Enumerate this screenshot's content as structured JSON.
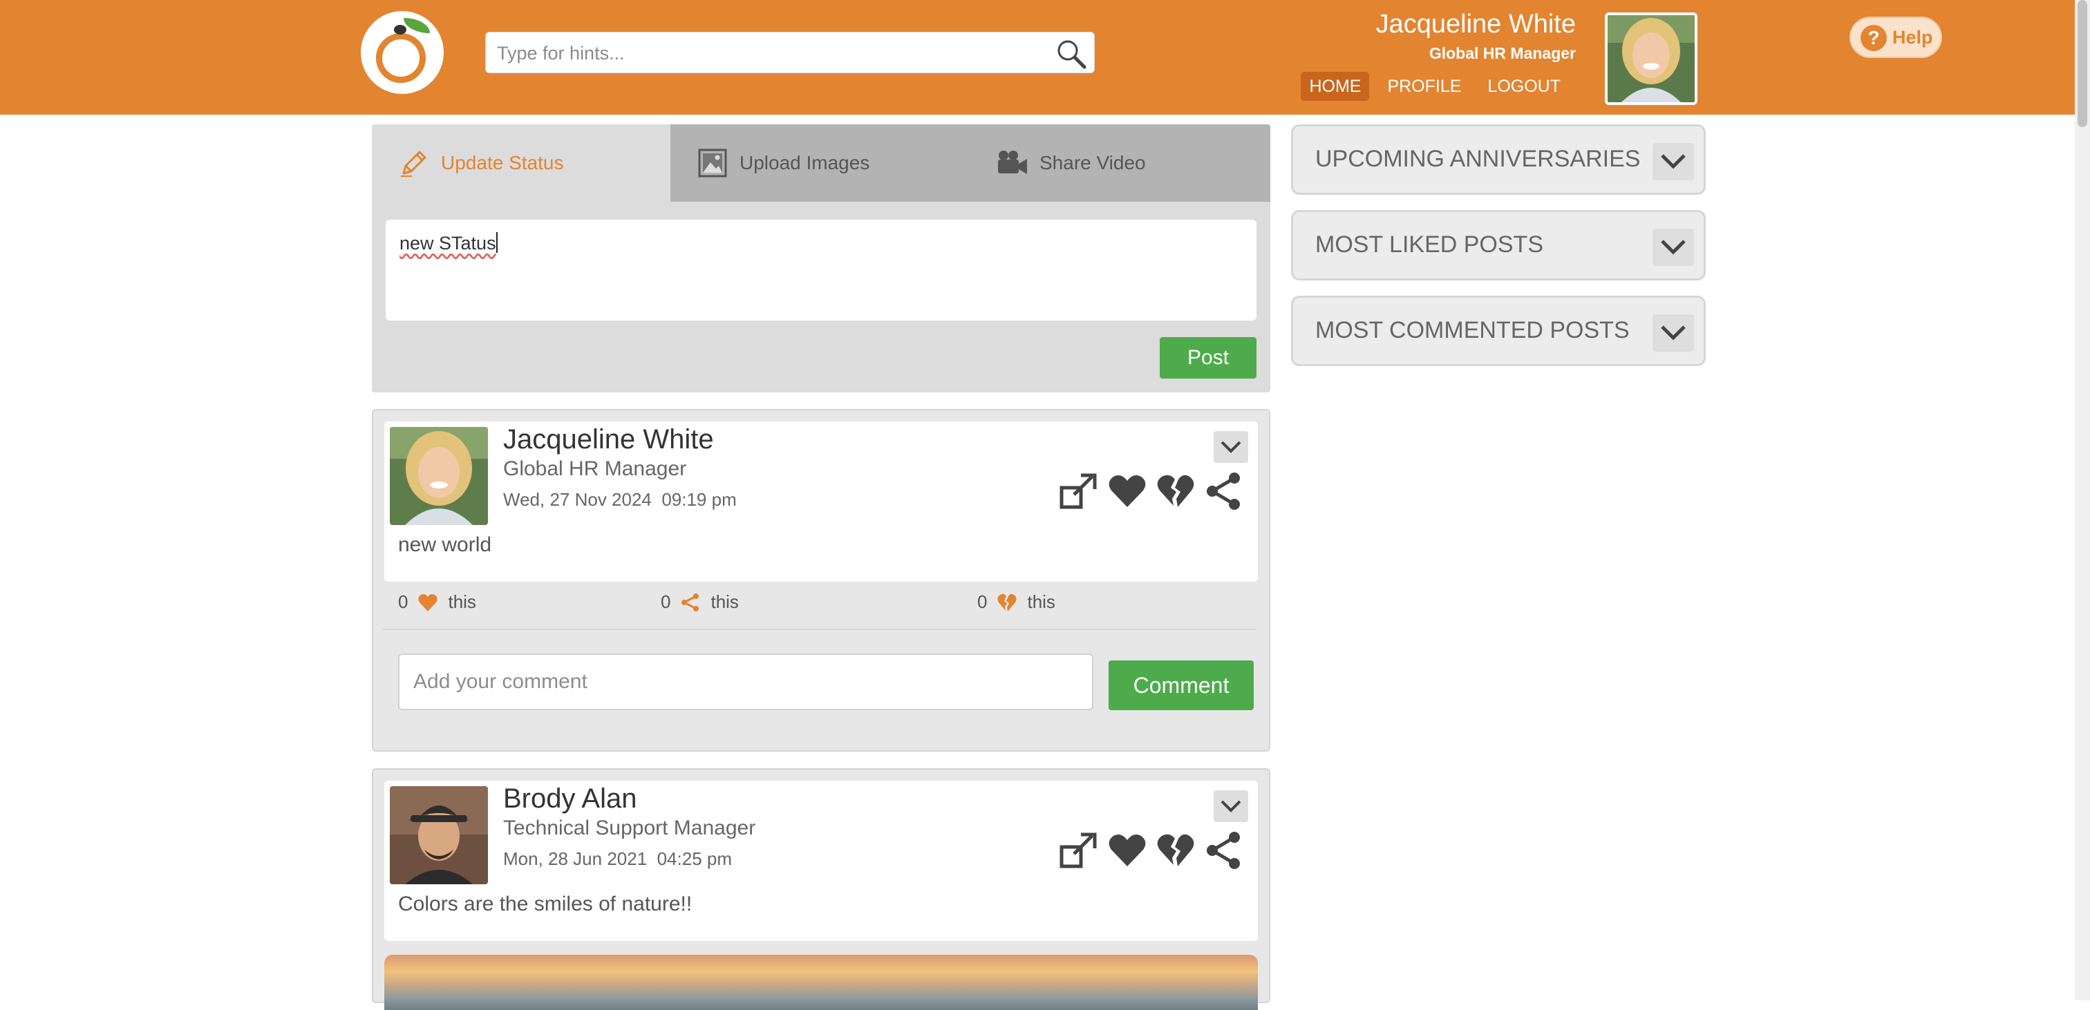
{
  "header": {
    "search_placeholder": "Type for hints...",
    "user_name": "Jacqueline White",
    "user_role": "Global HR Manager",
    "nav": [
      "HOME",
      "PROFILE",
      "LOGOUT"
    ],
    "active_nav": "HOME",
    "help_label": "Help",
    "brand_color": "#e38431"
  },
  "composer": {
    "tabs": [
      {
        "label": "Update Status",
        "icon": "pencil-icon",
        "active": true
      },
      {
        "label": "Upload Images",
        "icon": "image-icon",
        "active": false
      },
      {
        "label": "Share Video",
        "icon": "video-camera-icon",
        "active": false
      }
    ],
    "status_text": "new STatus",
    "post_label": "Post"
  },
  "widgets": [
    {
      "title": "UPCOMING ANNIVERSARIES"
    },
    {
      "title": "MOST LIKED POSTS"
    },
    {
      "title": "MOST COMMENTED POSTS"
    }
  ],
  "posts": [
    {
      "author": "Jacqueline White",
      "role": "Global HR Manager",
      "date": "Wed, 27 Nov 2024  09:19 pm",
      "text": "new world",
      "likes": "0",
      "shares": "0",
      "dislikes": "0",
      "likes_label": "this",
      "shares_label": "this",
      "dislikes_label": "this",
      "comment_placeholder": "Add your comment",
      "comment_label": "Comment"
    },
    {
      "author": "Brody Alan",
      "role": "Technical Support Manager",
      "date": "Mon, 28 Jun 2021  04:25 pm",
      "text": "Colors are the smiles of nature!!"
    }
  ],
  "colors": {
    "accent": "#e38431",
    "button_green": "#4eab4b"
  }
}
